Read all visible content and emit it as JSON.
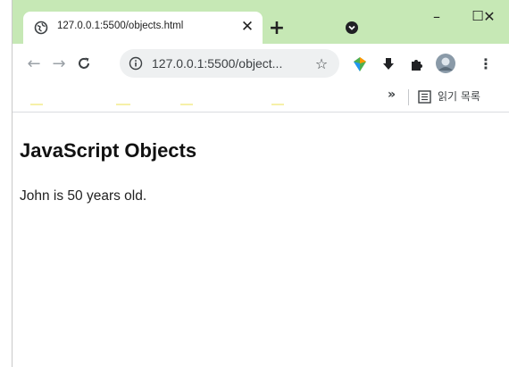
{
  "browser": {
    "tab": {
      "title": "127.0.0.1:5500/objects.html",
      "close_glyph": "✕",
      "favicon": "globe-icon"
    },
    "new_tab_glyph": "+",
    "window_controls": {
      "minimize": "–",
      "maximize": "☐",
      "close": "✕"
    },
    "toolbar": {
      "back_glyph": "←",
      "forward_glyph": "→",
      "reload_glyph": "C",
      "url": "127.0.0.1:5500/object...",
      "bookmark_glyph": "☆",
      "menu_glyph": "⋮"
    },
    "bookmarks_bar": {
      "overflow_glyph": "»",
      "reading_list_label": "읽기 목록"
    },
    "colors": {
      "tabstrip": "#c6e8b5",
      "toolbar": "#ffffff"
    }
  },
  "page": {
    "heading": "JavaScript Objects",
    "output": "John is 50 years old."
  }
}
